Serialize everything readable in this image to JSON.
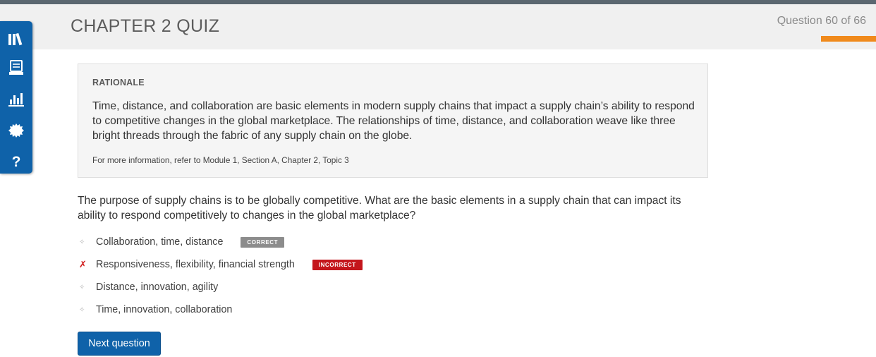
{
  "header": {
    "title": "CHAPTER 2 QUIZ",
    "question_counter": "Question 60 of 66",
    "progress_fraction": 0.909,
    "accent_color": "#f08a1c"
  },
  "sidebar": {
    "color": "#0f62a9",
    "items": [
      {
        "icon": "library-icon"
      },
      {
        "icon": "notes-icon"
      },
      {
        "icon": "bar-chart-icon"
      },
      {
        "icon": "gear-icon"
      },
      {
        "icon": "help-icon"
      }
    ]
  },
  "rationale": {
    "heading": "RATIONALE",
    "body": "Time, distance, and collaboration are basic elements in modern supply chains that impact a supply chain’s ability to respond to competitive changes in the global marketplace. The relationships of time, distance, and collaboration weave like three bright threads through the fabric of any supply chain on the globe.",
    "reference": "For more information, refer to Module 1, Section A, Chapter 2, Topic 3"
  },
  "question": {
    "text": "The purpose of supply chains is to be globally competitive. What are the basic elements in a supply chain that can impact its ability to respond competitively to changes in the global marketplace?"
  },
  "answers": [
    {
      "text": "Collaboration, time, distance",
      "marker": "✧",
      "badge": "CORRECT",
      "status": "correct"
    },
    {
      "text": "Responsiveness, flexibility, financial strength",
      "marker": "✗",
      "badge": "INCORRECT",
      "status": "incorrect"
    },
    {
      "text": "Distance, innovation, agility",
      "marker": "✧",
      "badge": "",
      "status": "none"
    },
    {
      "text": "Time, innovation, collaboration",
      "marker": "✧",
      "badge": "",
      "status": "none"
    }
  ],
  "buttons": {
    "next_label": "Next question"
  }
}
